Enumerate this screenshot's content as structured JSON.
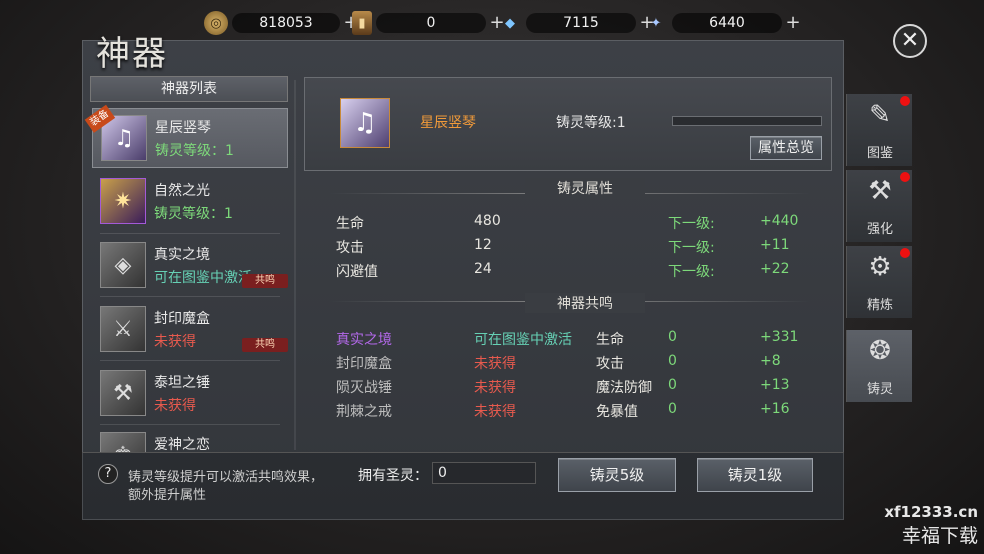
{
  "currencies": [
    {
      "icon": "coin-icon",
      "value": "818053"
    },
    {
      "icon": "card-icon",
      "value": "0"
    },
    {
      "icon": "blue-crystal-icon",
      "value": "7115"
    },
    {
      "icon": "diamond-icon",
      "value": "6440"
    }
  ],
  "plus_glyph": "+",
  "title": "神器",
  "list": {
    "header": "神器列表",
    "items": [
      {
        "name": "星辰竖琴",
        "status": "铸灵等级：1",
        "corner": "装备"
      },
      {
        "name": "自然之光",
        "status": "铸灵等级：1"
      },
      {
        "name": "真实之境",
        "status": "可在图鉴中激活",
        "tag": "共鸣"
      },
      {
        "name": "封印魔盒",
        "status": "未获得",
        "tag": "共鸣"
      },
      {
        "name": "泰坦之锤",
        "status": "未获得"
      },
      {
        "name": "爱神之恋",
        "status": ""
      }
    ]
  },
  "detail": {
    "name": "星辰竖琴",
    "level_label": "铸灵等级:1",
    "overview_button": "属性总览"
  },
  "attributes": {
    "header": "铸灵属性",
    "rows": [
      {
        "name": "生命",
        "value": "480",
        "next_label": "下一级:",
        "next_value": "+440"
      },
      {
        "name": "攻击",
        "value": "12",
        "next_label": "下一级:",
        "next_value": "+11"
      },
      {
        "name": "闪避值",
        "value": "24",
        "next_label": "下一级:",
        "next_value": "+22"
      }
    ]
  },
  "resonance": {
    "header": "神器共鸣",
    "rows": [
      {
        "name": "真实之境",
        "status": "可在图鉴中激活",
        "attr": "生命",
        "value": "0",
        "bonus": "+331"
      },
      {
        "name": "封印魔盒",
        "status": "未获得",
        "attr": "攻击",
        "value": "0",
        "bonus": "+8"
      },
      {
        "name": "陨灭战锤",
        "status": "未获得",
        "attr": "魔法防御",
        "value": "0",
        "bonus": "+13"
      },
      {
        "name": "荆棘之戒",
        "status": "未获得",
        "attr": "免暴值",
        "value": "0",
        "bonus": "+16"
      }
    ]
  },
  "footer": {
    "help_icon": "?",
    "hint_line1": "铸灵等级提升可以激活共鸣效果，",
    "hint_line2": "额外提升属性",
    "owned_label": "拥有圣灵：",
    "owned_value": "0",
    "btn_forge5": "铸灵5级",
    "btn_forge1": "铸灵1级"
  },
  "side_tabs": [
    {
      "label": "图鉴",
      "icon": "book-icon",
      "dot": true
    },
    {
      "label": "强化",
      "icon": "hammer-icon",
      "dot": true
    },
    {
      "label": "精炼",
      "icon": "anvil-icon",
      "dot": true
    },
    {
      "label": "铸灵",
      "icon": "soul-emblem-icon",
      "dot": false,
      "active": true
    }
  ],
  "watermark": {
    "site": "xf12333.cn",
    "name": "幸福下载"
  },
  "colors": {
    "accent_orange": "#f09a3a",
    "green": "#7dd97a",
    "red": "#e85a4e",
    "purple": "#b268e8"
  }
}
